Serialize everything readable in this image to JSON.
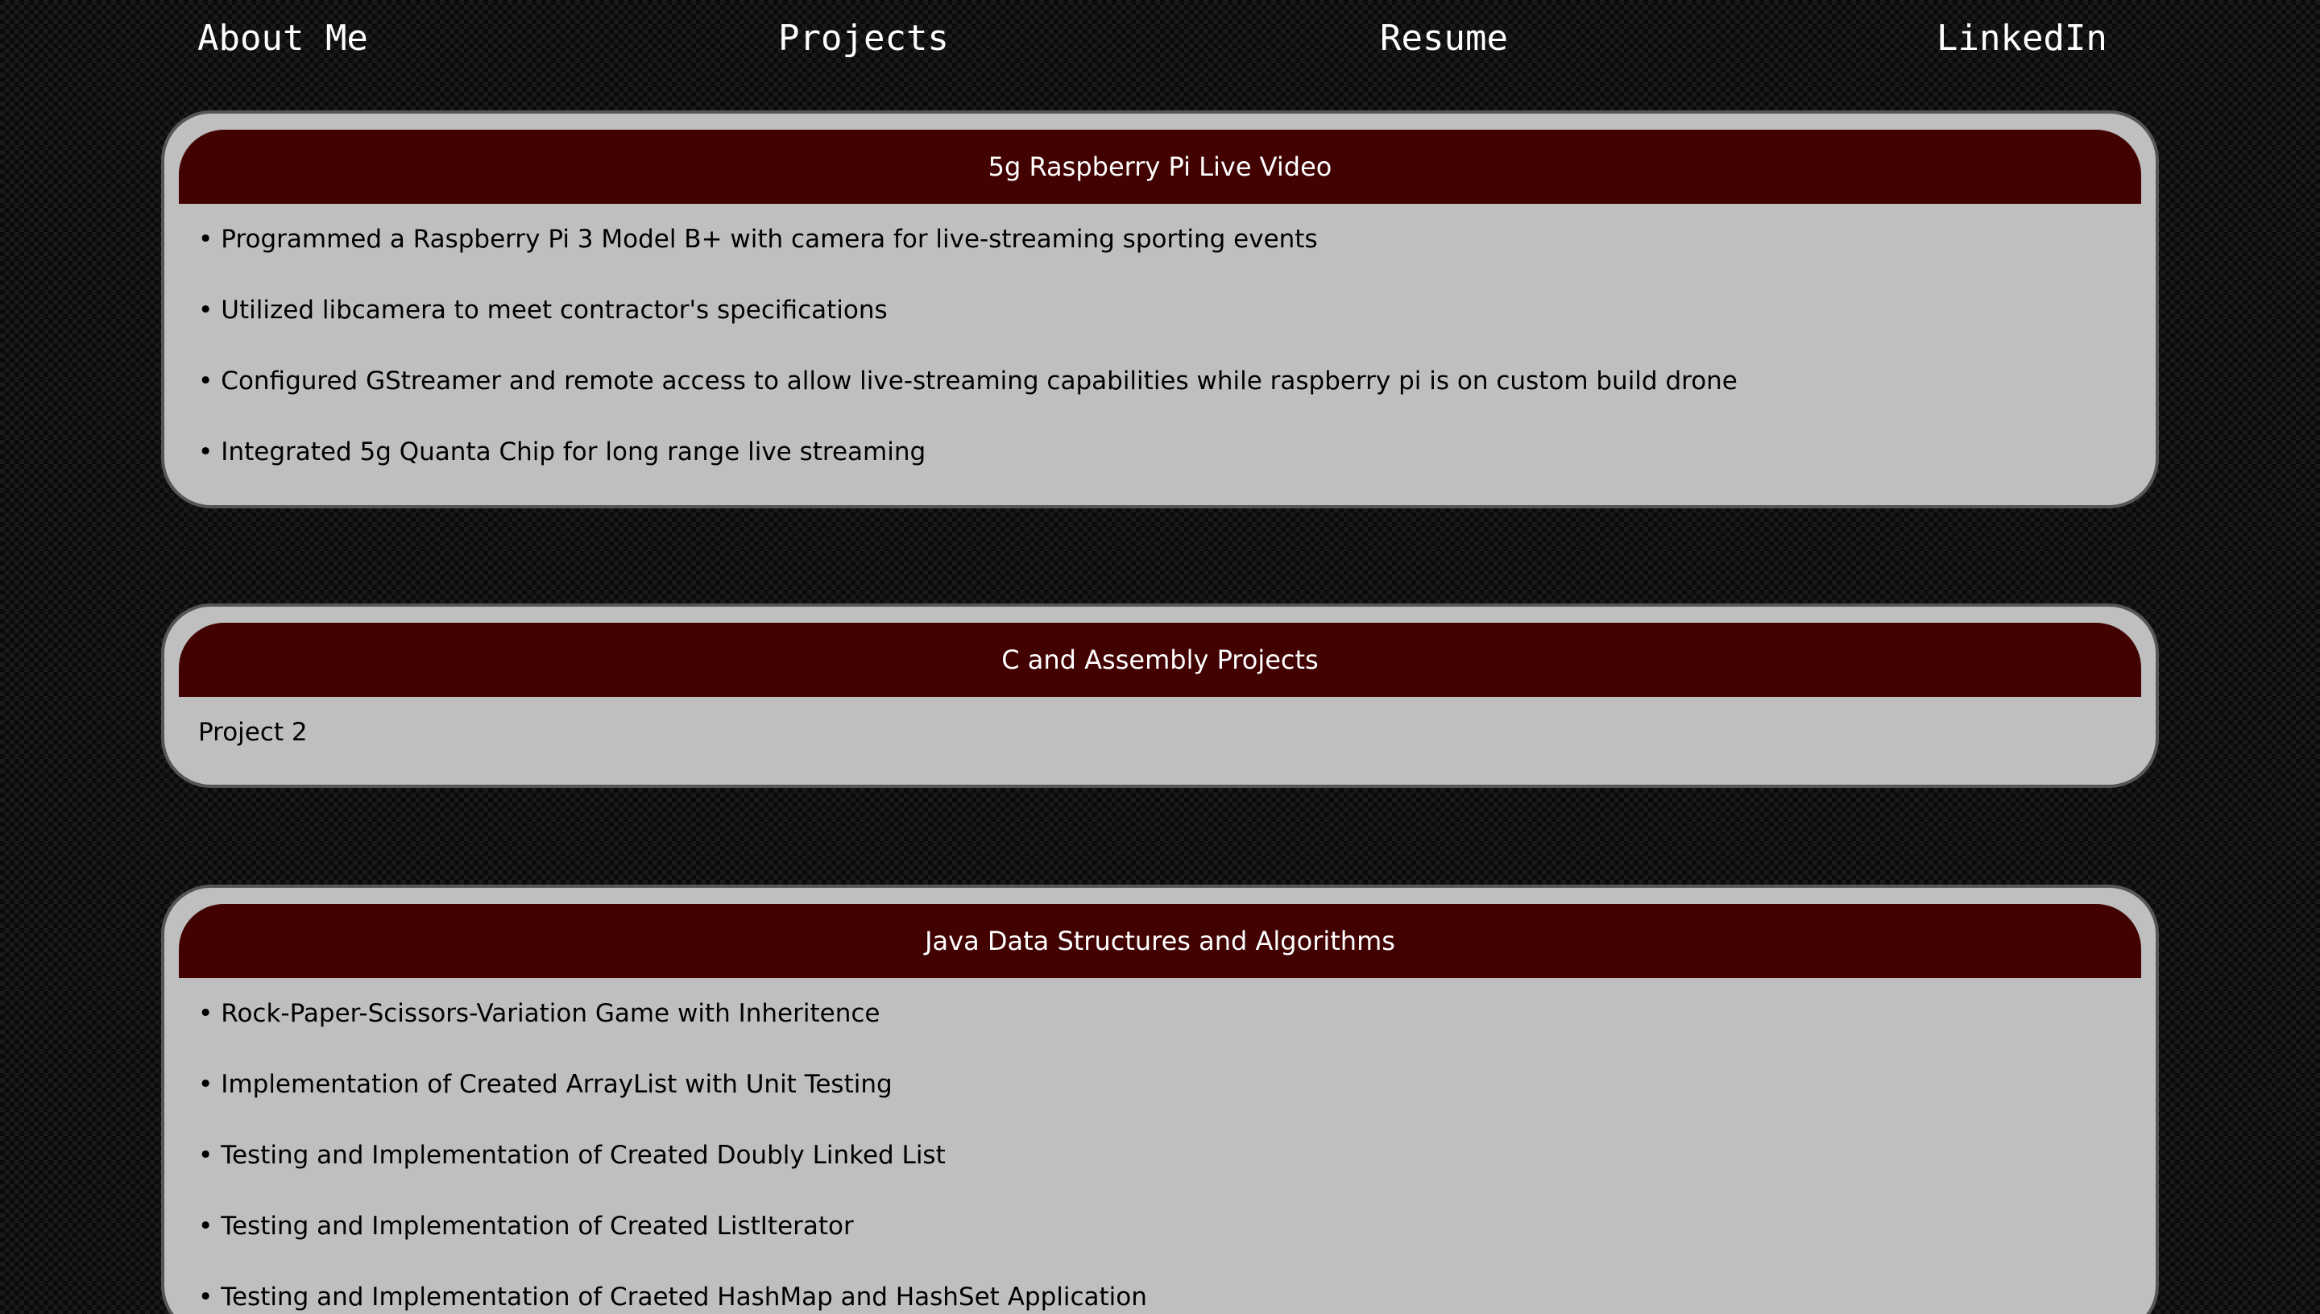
{
  "nav": {
    "items": [
      {
        "label": "About Me"
      },
      {
        "label": "Projects"
      },
      {
        "label": "Resume"
      },
      {
        "label": "LinkedIn"
      }
    ]
  },
  "cards": [
    {
      "title": "5g Raspberry Pi Live Video",
      "items": [
        "Programmed a Raspberry Pi 3 Model B+ with camera for live-streaming sporting events",
        "Utilized libcamera to meet contractor's specifications",
        "Configured GStreamer and remote access to allow live-streaming capabilities while raspberry pi is on custom build drone",
        "Integrated 5g Quanta Chip for long range live streaming"
      ]
    },
    {
      "title": "C and Assembly Projects",
      "text": "Project 2"
    },
    {
      "title": "Java Data Structures and Algorithms",
      "items": [
        "Rock-Paper-Scissors-Variation Game with Inheritence",
        "Implementation of Created ArrayList with Unit Testing",
        "Testing and Implementation of Created Doubly Linked List",
        "Testing and Implementation of Created ListIterator",
        "Testing and Implementation of Craeted HashMap and HashSet Application"
      ]
    }
  ],
  "bullet_symbol": "•",
  "colors": {
    "header_bg": "#420202",
    "card_bg": "#bfbfbf",
    "card_border": "#555555",
    "page_bg": "#0b0b0b"
  }
}
